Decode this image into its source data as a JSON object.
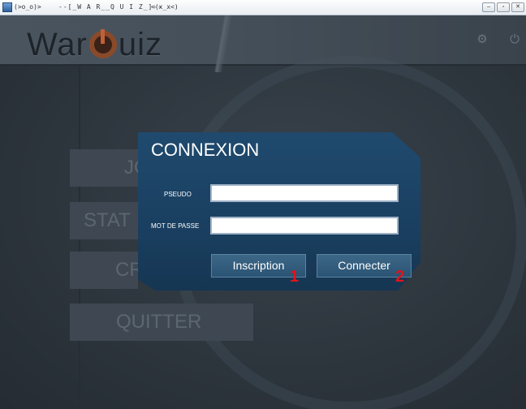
{
  "window": {
    "title_left": "(>o_o)>",
    "title_center": "--[_W A R__Q U I Z_]--",
    "title_right": "<(x_x<)",
    "buttons": [
      "minimize",
      "maximize",
      "close"
    ],
    "icons": {
      "minimize": "–",
      "maximize": "▫",
      "close": "✕"
    }
  },
  "header": {
    "logo_left": "War",
    "logo_right": "uiz",
    "settings_icon": "gear-icon",
    "power_icon": "power-icon"
  },
  "menu": {
    "items": [
      "JO",
      "STAT",
      "CRE",
      "QUITTER"
    ]
  },
  "login": {
    "title": "CONNEXION",
    "pseudo_label": "PSEUDO",
    "password_label": "MOT DE PASSE",
    "pseudo_value": "",
    "password_value": "",
    "inscription_label": "Inscription",
    "connect_label": "Connecter",
    "marker_1": "1",
    "marker_2": "2"
  },
  "colors": {
    "dialog": "#1f4a6e",
    "button": "#2f5a7c",
    "marker": "#e0141a"
  }
}
